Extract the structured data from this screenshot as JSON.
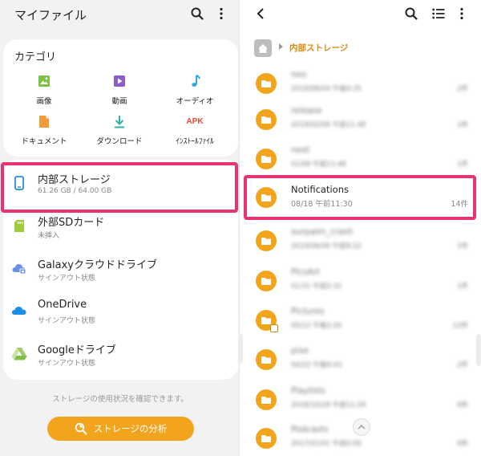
{
  "left": {
    "title": "マイファイル",
    "categories_title": "カテゴリ",
    "categories": [
      {
        "label": "画像",
        "icon": "image-icon"
      },
      {
        "label": "動画",
        "icon": "video-icon"
      },
      {
        "label": "オーディオ",
        "icon": "audio-icon"
      },
      {
        "label": "ドキュメント",
        "icon": "document-icon"
      },
      {
        "label": "ダウンロード",
        "icon": "download-icon"
      },
      {
        "label": "ｲﾝｽﾄｰﾙﾌｧｲﾙ",
        "icon": "apk-icon",
        "icon_text": "APK"
      }
    ],
    "storage": [
      {
        "name": "内部ストレージ",
        "sub": "61.26 GB / 64.00 GB",
        "icon": "phone-icon"
      },
      {
        "name": "外部SDカード",
        "sub": "未挿入",
        "icon": "sd-card-icon"
      },
      {
        "name": "Galaxyクラウドドライブ",
        "sub": "サインアウト状態",
        "icon": "cloud-icon"
      },
      {
        "name": "OneDrive",
        "sub": "サインアウト状態",
        "icon": "onedrive-icon"
      },
      {
        "name": "Googleドライブ",
        "sub": "サインアウト状態",
        "icon": "google-drive-icon"
      }
    ],
    "note": "ストレージの使用状況を確認できます。",
    "analyze_label": "ストレージの分析"
  },
  "right": {
    "path_label": "内部ストレージ",
    "folders": [
      {
        "name": "neo",
        "date": "2019/06/04 午後4:35",
        "count": "2件",
        "blur": true
      },
      {
        "name": "release",
        "date": "2019/02/06 午前11:48",
        "count": "1件",
        "blur": true
      },
      {
        "name": "next",
        "date": "01/08 午前11:48",
        "count": "1件",
        "blur": true
      },
      {
        "name": "Notifications",
        "date": "08/18 午前11:30",
        "count": "14件",
        "blur": false
      },
      {
        "name": "ourpalm_crash",
        "date": "2019/06/06 午前9:22",
        "count": "1件",
        "blur": true
      },
      {
        "name": "PicsArt",
        "date": "01/31 午前2:31",
        "count": "1件",
        "blur": true
      },
      {
        "name": "Pictures",
        "date": "05/12 午後2:20",
        "count": "12件",
        "blur": true
      },
      {
        "name": "pixe",
        "date": "04/22 午後9:43",
        "count": "2件",
        "blur": true
      },
      {
        "name": "Playlists",
        "date": "2018/10/28 午前11:29",
        "count": "0件",
        "blur": true
      },
      {
        "name": "Podcasts",
        "date": "2017/01/01 午前0:00",
        "count": "0件",
        "blur": true
      }
    ]
  },
  "colors": {
    "accent": "#f2a51c",
    "highlight": "#e63470",
    "path": "#d88b10"
  }
}
